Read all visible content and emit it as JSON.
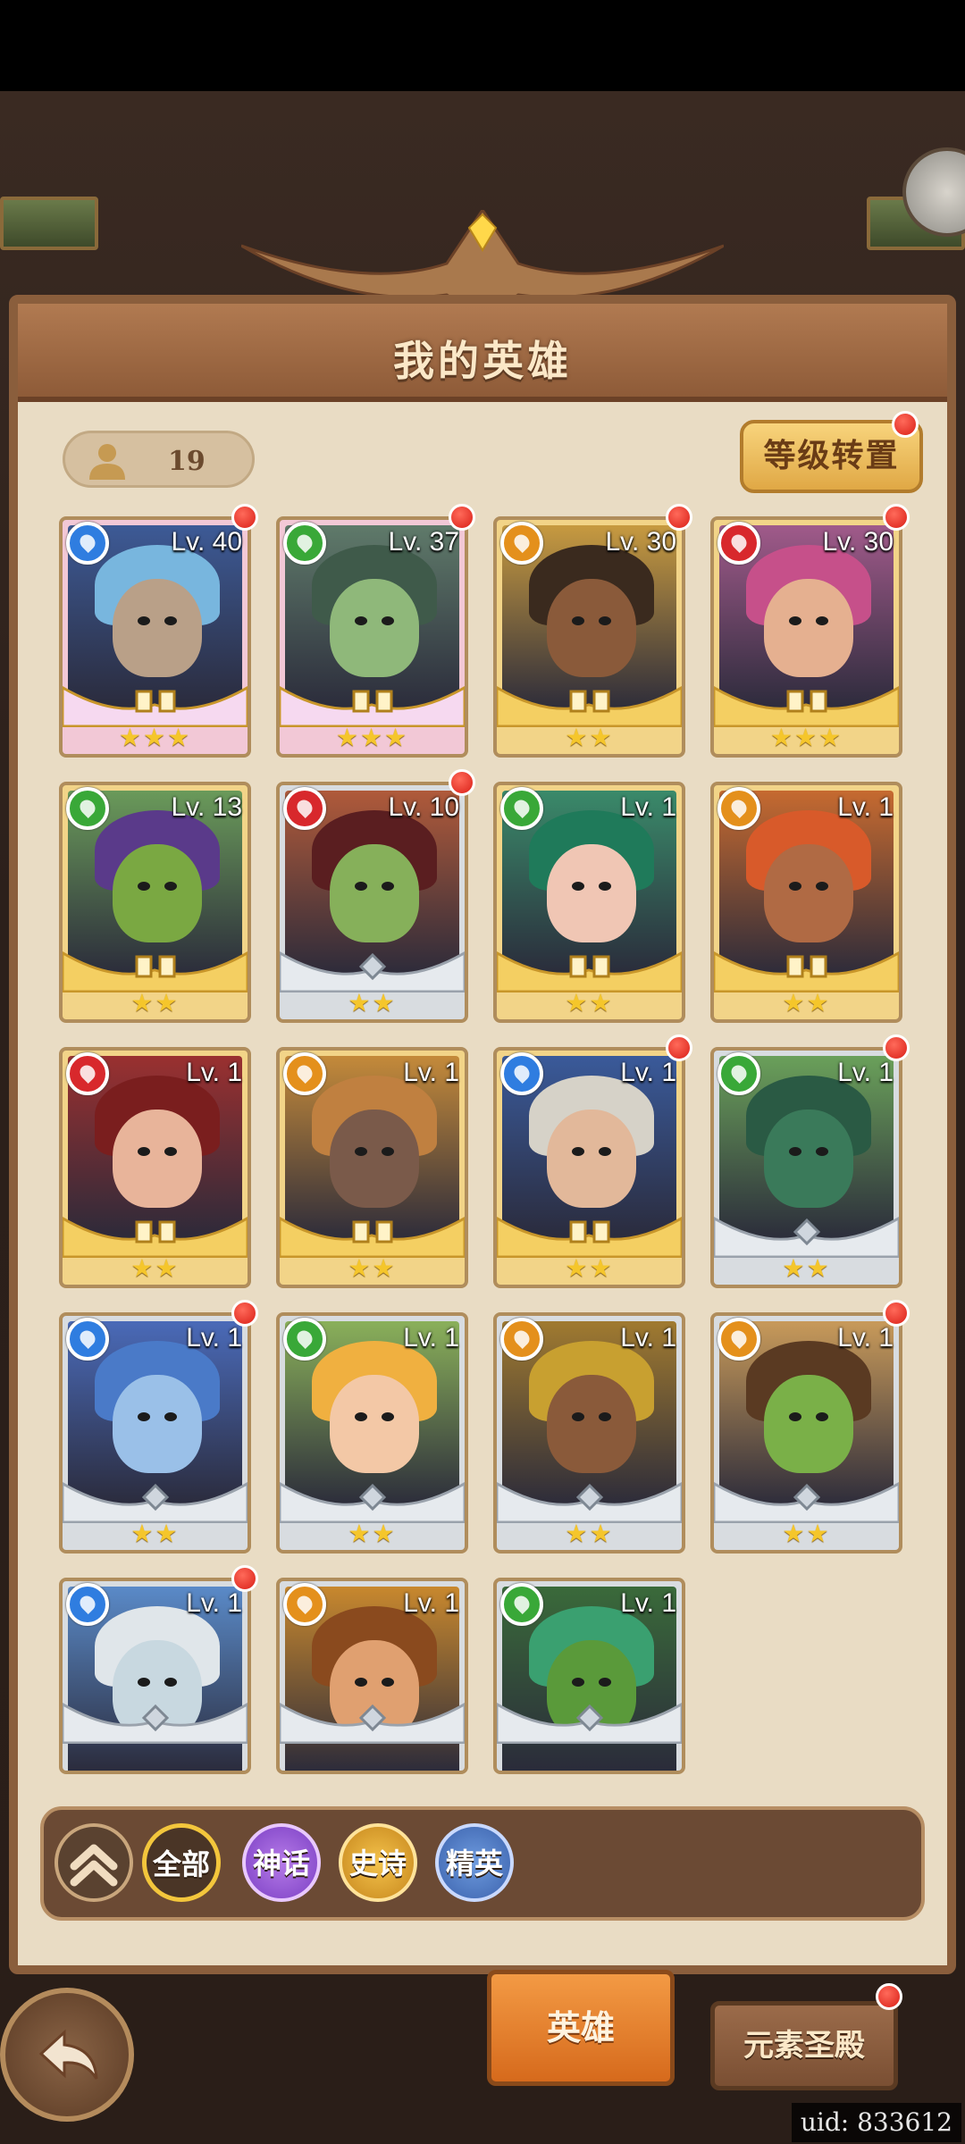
{
  "header": {
    "title": "我的英雄"
  },
  "toolbar": {
    "hero_count": "19",
    "level_reset_label": "等级转置"
  },
  "colors": {
    "water": "#2f7de0",
    "wood": "#39a838",
    "earth": "#e4901c",
    "fire": "#d8282c"
  },
  "heroes": [
    {
      "level": "Lv. 40",
      "element": "water",
      "rarity": "legend",
      "stars": "★★★",
      "red_dot": true,
      "skin": "#b9a088",
      "hair": "#78b6de",
      "bg": "#3d5a96"
    },
    {
      "level": "Lv. 37",
      "element": "wood",
      "rarity": "legend",
      "stars": "★★★",
      "red_dot": true,
      "skin": "#8fb87a",
      "hair": "#3f5a4a",
      "bg": "#5f7a6a"
    },
    {
      "level": "Lv. 30",
      "element": "earth",
      "rarity": "epic",
      "stars": "★★",
      "red_dot": true,
      "skin": "#8a5a3a",
      "hair": "#3a2a1e",
      "bg": "#c79a40"
    },
    {
      "level": "Lv. 30",
      "element": "fire",
      "rarity": "epic",
      "stars": "★★★",
      "red_dot": true,
      "skin": "#e5b090",
      "hair": "#c6508a",
      "bg": "#a05a8a"
    },
    {
      "level": "Lv. 13",
      "element": "wood",
      "rarity": "epic",
      "stars": "★★",
      "red_dot": false,
      "skin": "#7aa842",
      "hair": "#5a3a8a",
      "bg": "#6a9a5a"
    },
    {
      "level": "Lv. 10",
      "element": "fire",
      "rarity": "elite",
      "stars": "★★",
      "red_dot": true,
      "skin": "#86b05a",
      "hair": "#5a1e20",
      "bg": "#b05a3a"
    },
    {
      "level": "Lv. 1",
      "element": "wood",
      "rarity": "epic",
      "stars": "★★",
      "red_dot": false,
      "skin": "#f0c6b4",
      "hair": "#1f7a5a",
      "bg": "#3a8a6a"
    },
    {
      "level": "Lv. 1",
      "element": "earth",
      "rarity": "epic",
      "stars": "★★",
      "red_dot": false,
      "skin": "#b06a44",
      "hair": "#d85a2a",
      "bg": "#c66a30"
    },
    {
      "level": "Lv. 1",
      "element": "fire",
      "rarity": "epic",
      "stars": "★★",
      "red_dot": false,
      "skin": "#e8b49a",
      "hair": "#7a1e1e",
      "bg": "#9a3030"
    },
    {
      "level": "Lv. 1",
      "element": "earth",
      "rarity": "epic",
      "stars": "★★",
      "red_dot": false,
      "skin": "#7a5a4a",
      "hair": "#c08040",
      "bg": "#c48a3a"
    },
    {
      "level": "Lv. 1",
      "element": "water",
      "rarity": "epic",
      "stars": "★★",
      "red_dot": true,
      "skin": "#e2b89a",
      "hair": "#d6d2c8",
      "bg": "#3a5a9a"
    },
    {
      "level": "Lv. 1",
      "element": "wood",
      "rarity": "elite",
      "stars": "★★",
      "red_dot": true,
      "skin": "#3a7a5a",
      "hair": "#2a5a44",
      "bg": "#6aa05a"
    },
    {
      "level": "Lv. 1",
      "element": "water",
      "rarity": "elite",
      "stars": "★★",
      "red_dot": true,
      "skin": "#9ac0e8",
      "hair": "#4a7ac8",
      "bg": "#4a6ab8"
    },
    {
      "level": "Lv. 1",
      "element": "wood",
      "rarity": "elite",
      "stars": "★★",
      "red_dot": false,
      "skin": "#f3c8a6",
      "hair": "#f0b040",
      "bg": "#8ab05a"
    },
    {
      "level": "Lv. 1",
      "element": "earth",
      "rarity": "elite",
      "stars": "★★",
      "red_dot": false,
      "skin": "#8a5a3a",
      "hair": "#c8a030",
      "bg": "#a07a30"
    },
    {
      "level": "Lv. 1",
      "element": "earth",
      "rarity": "elite",
      "stars": "★★",
      "red_dot": true,
      "skin": "#7ab048",
      "hair": "#5a3a22",
      "bg": "#c89a5a"
    },
    {
      "level": "Lv. 1",
      "element": "water",
      "rarity": "elite",
      "stars": "",
      "red_dot": true,
      "skin": "#c8d8e0",
      "hair": "#e0e6ea",
      "bg": "#5a8ac8"
    },
    {
      "level": "Lv. 1",
      "element": "earth",
      "rarity": "elite",
      "stars": "",
      "red_dot": false,
      "skin": "#e0a070",
      "hair": "#8a4a1e",
      "bg": "#c8882e"
    },
    {
      "level": "Lv. 1",
      "element": "wood",
      "rarity": "elite",
      "stars": "",
      "red_dot": false,
      "skin": "#5a9a3a",
      "hair": "#3aa070",
      "bg": "#3a6a3a"
    }
  ],
  "filters": {
    "collapse_icon": "double-chevron-up-icon",
    "all": "全部",
    "myth": "神话",
    "epic": "史诗",
    "elite": "精英"
  },
  "bottom_nav": {
    "heroes": "英雄",
    "element_temple": "元素圣殿",
    "back_icon": "back-arrow-icon"
  },
  "uid": "uid: 833612"
}
